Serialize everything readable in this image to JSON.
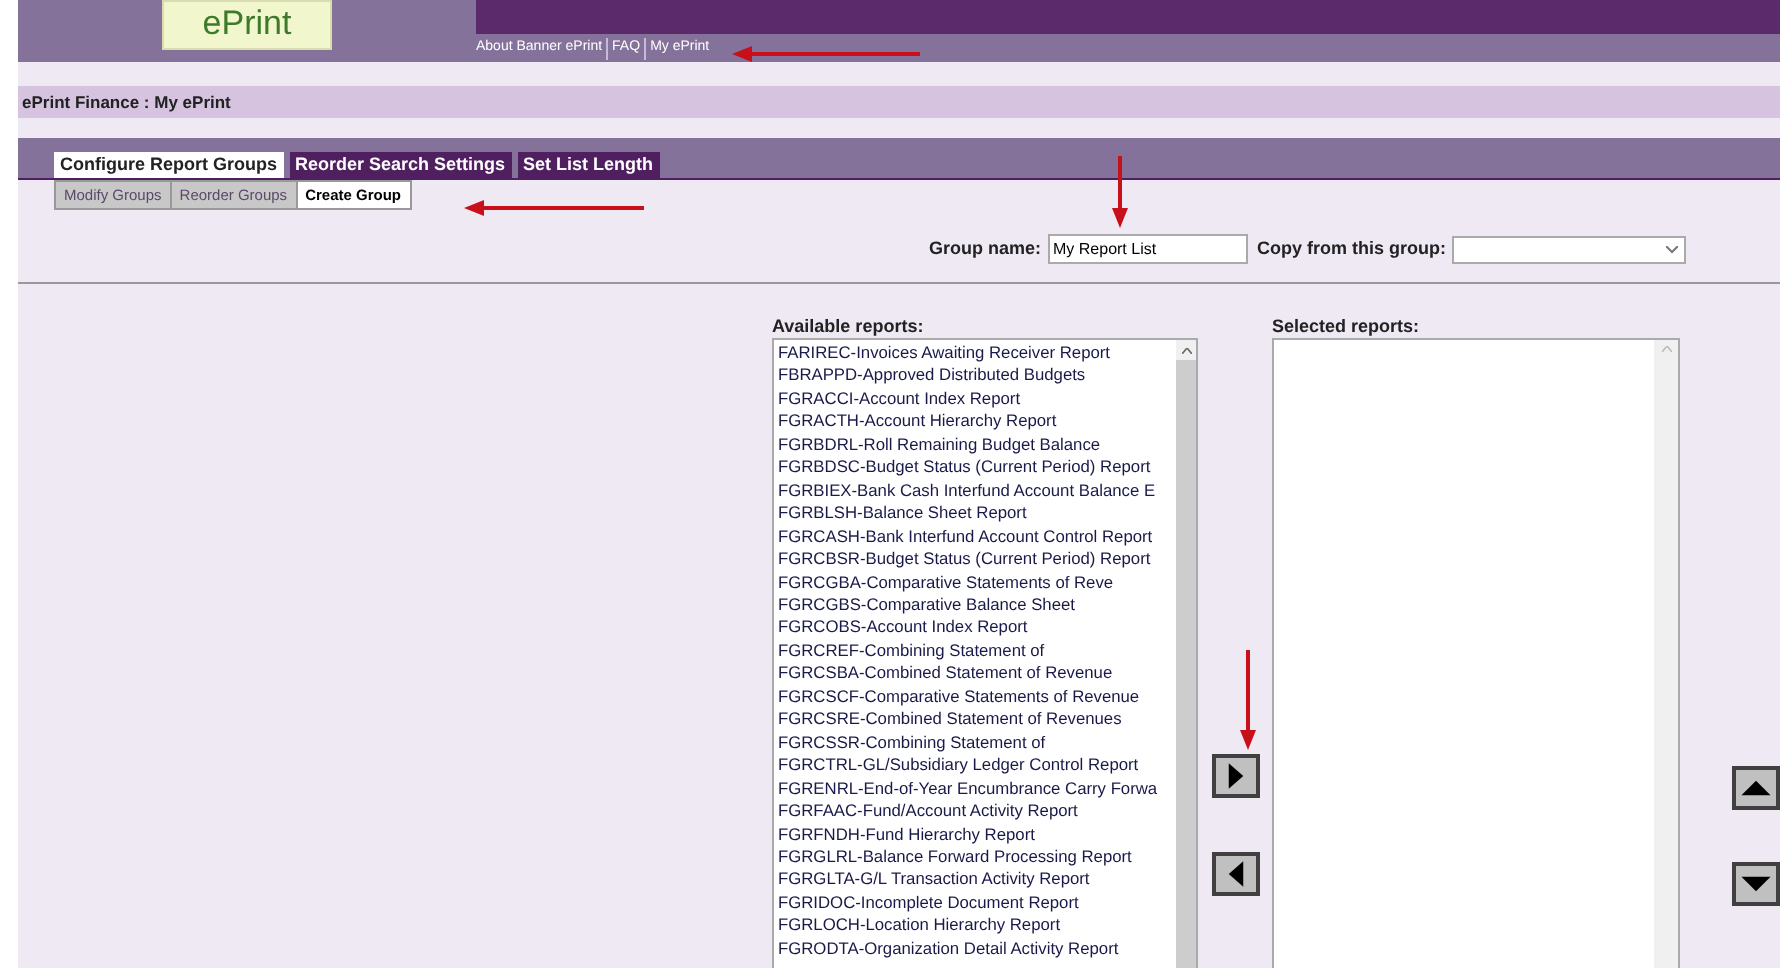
{
  "header": {
    "logo": "ePrint",
    "links": [
      "About Banner ePrint",
      "FAQ",
      "My ePrint"
    ]
  },
  "breadcrumb": "ePrint Finance : My ePrint",
  "tabs": [
    {
      "label": "Configure Report Groups",
      "selected": true
    },
    {
      "label": "Reorder Search Settings",
      "selected": false
    },
    {
      "label": "Set List Length",
      "selected": false
    }
  ],
  "subtabs": [
    {
      "label": "Modify Groups",
      "selected": false
    },
    {
      "label": "Reorder Groups",
      "selected": false
    },
    {
      "label": "Create Group",
      "selected": true
    }
  ],
  "form": {
    "group_name_label": "Group name:",
    "group_name_value": "My Report List",
    "copy_label": "Copy from this group:"
  },
  "available_reports": {
    "label": "Available reports:",
    "items": [
      "FARIREC-Invoices Awaiting Receiver Report",
      "FBRAPPD-Approved Distributed Budgets",
      "FGRACCI-Account Index Report",
      "FGRACTH-Account Hierarchy Report",
      "FGRBDRL-Roll Remaining Budget Balance",
      "FGRBDSC-Budget Status (Current Period) Report",
      "FGRBIEX-Bank Cash Interfund Account Balance E",
      "FGRBLSH-Balance Sheet Report",
      "FGRCASH-Bank Interfund Account Control Report",
      "FGRCBSR-Budget Status (Current Period) Report",
      "FGRCGBA-Comparative Statements of Reve",
      "FGRCGBS-Comparative Balance Sheet",
      "FGRCOBS-Account Index Report",
      "FGRCREF-Combining Statement of",
      "FGRCSBA-Combined Statement of Revenue",
      "FGRCSCF-Comparative Statements of Revenue",
      "FGRCSRE-Combined Statement of Revenues",
      "FGRCSSR-Combining Statement of",
      "FGRCTRL-GL/Subsidiary Ledger Control Report",
      "FGRENRL-End-of-Year Encumbrance Carry Forwa",
      "FGRFAAC-Fund/Account Activity Report",
      "FGRFNDH-Fund Hierarchy Report",
      "FGRGLRL-Balance Forward Processing Report",
      "FGRGLTA-G/L Transaction Activity Report",
      "FGRIDOC-Incomplete Document Report",
      "FGRLOCH-Location Hierarchy Report",
      "FGRODTA-Organization Detail Activity Report"
    ]
  },
  "selected_reports": {
    "label": "Selected reports:"
  }
}
